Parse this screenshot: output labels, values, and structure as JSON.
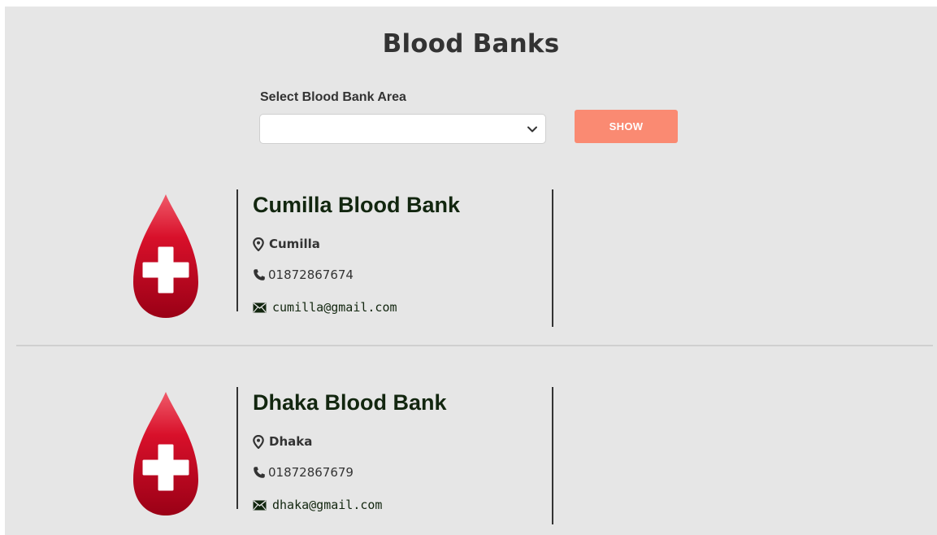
{
  "page": {
    "title": "Blood Banks"
  },
  "filter": {
    "label": "Select Blood Bank Area",
    "selected_value": "",
    "show_label": "SHOW"
  },
  "banks": [
    {
      "name": "Cumilla Blood Bank",
      "location": "Cumilla",
      "phone": "01872867674",
      "email": "cumilla@gmail.com"
    },
    {
      "name": "Dhaka Blood Bank",
      "location": "Dhaka",
      "phone": "01872867679",
      "email": "dhaka@gmail.com"
    }
  ],
  "icons": {
    "drop": "blood-drop-icon",
    "location": "map-pin-icon",
    "phone": "phone-icon",
    "email": "envelope-icon",
    "select": "chevron-down-icon"
  },
  "colors": {
    "background": "#e6e6e6",
    "accent_button": "#fa8a72",
    "drop_red": "#c0001a",
    "bank_name": "#12260f"
  }
}
